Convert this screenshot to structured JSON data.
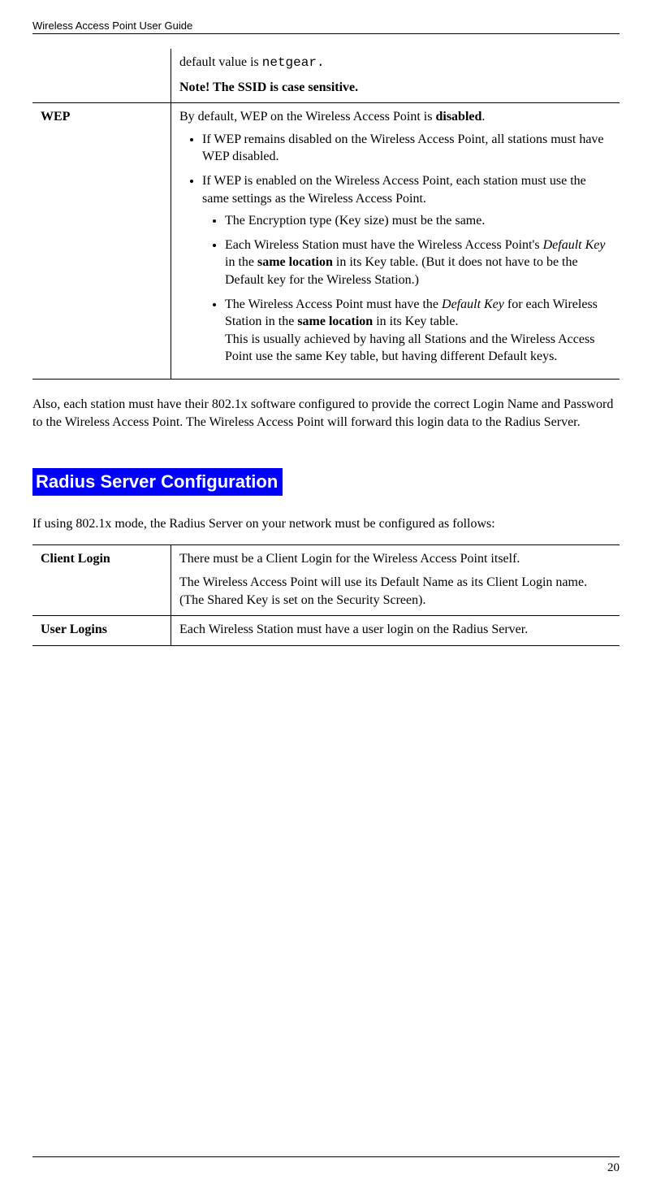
{
  "header": {
    "title": "Wireless Access Point User Guide"
  },
  "page_number": "20",
  "table1": {
    "ssid_row": {
      "value_prefix": "default value is ",
      "value_code": "netgear.",
      "note_strong": "Note! The SSID is case sensitive."
    },
    "wep_row": {
      "term": "WEP",
      "intro_pre": "By default, WEP on the Wireless Access Point is ",
      "intro_strong": "disabled",
      "intro_suf": ".",
      "b1": "If WEP remains disabled on the Wireless Access Point, all stations must have WEP disabled.",
      "b2": "If WEP is enabled on the Wireless Access Point, each station must use the same settings as the Wireless Access Point.",
      "s1": "The Encryption type (Key size) must be the same.",
      "s2_pre": "Each Wireless Station must have the Wireless Access Point's ",
      "s2_em1": "Default Key",
      "s2_mid1": " in the ",
      "s2_strong": "same location",
      "s2_suf": " in its Key table. (But it does not have to be the Default key for the Wireless Station.)",
      "s3_pre": "The Wireless Access Point must have the ",
      "s3_em": "Default Key",
      "s3_mid": " for each Wireless Station in the ",
      "s3_strong": "same location",
      "s3_suf": " in its Key table.",
      "s3_line2": "This is usually achieved by having all Stations and the Wireless Access Point use the same Key table, but having different Default keys."
    }
  },
  "para1": "Also, each station must have their 802.1x software configured to provide the correct Login Name and Password to the Wireless Access Point. The Wireless Access Point will forward this login data to the Radius Server.",
  "section_title": "Radius Server Configuration",
  "para2": "If using 802.1x mode, the Radius Server on your network must be configured as follows:",
  "table2": {
    "r1": {
      "term": "Client Login",
      "line1": "There must be a Client Login for the Wireless Access Point itself.",
      "line2": "The Wireless Access Point will use its Default Name as its Client Login name. (The Shared Key is set on the Security Screen)."
    },
    "r2": {
      "term": "User Logins",
      "line1": "Each Wireless Station must have a user login on the Radius Server."
    }
  }
}
